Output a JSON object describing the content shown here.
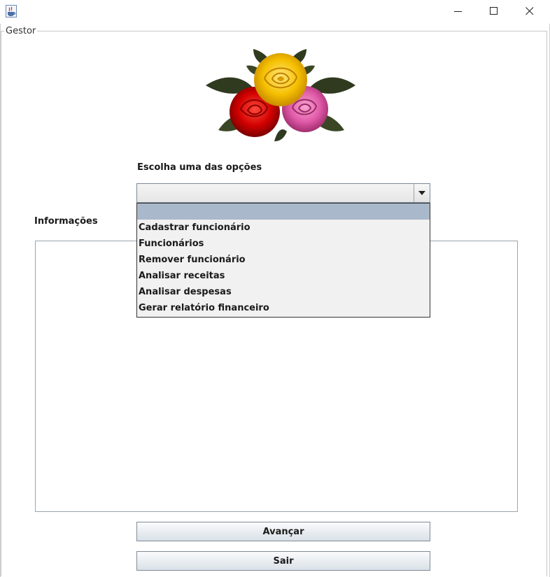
{
  "window": {
    "title": "",
    "group_title": "Gestor"
  },
  "form": {
    "choose_label": "Escolha uma das opções",
    "combo_selected": "",
    "info_label": "Informações",
    "info_text": ""
  },
  "dropdown": {
    "items": [
      {
        "label": ""
      },
      {
        "label": "Cadastrar funcionário"
      },
      {
        "label": "Funcionários"
      },
      {
        "label": "Remover funcionário"
      },
      {
        "label": "Analisar receitas"
      },
      {
        "label": "Analisar despesas"
      },
      {
        "label": "Gerar relatório financeiro"
      }
    ],
    "selected_index": 0
  },
  "buttons": {
    "next_label": "Avançar",
    "exit_label": "Sair"
  },
  "icons": {
    "app": "java-cup-icon",
    "minimize": "minimize-icon",
    "maximize": "maximize-icon",
    "close": "close-icon",
    "combo_arrow": "chevron-down-icon",
    "logo": "roses-bouquet-icon"
  },
  "colors": {
    "selection": "#a9b8cb",
    "rose_yellow": "#f5c000",
    "rose_red": "#d10000",
    "rose_pink": "#e05aa8",
    "leaf": "#2f3a1f"
  }
}
